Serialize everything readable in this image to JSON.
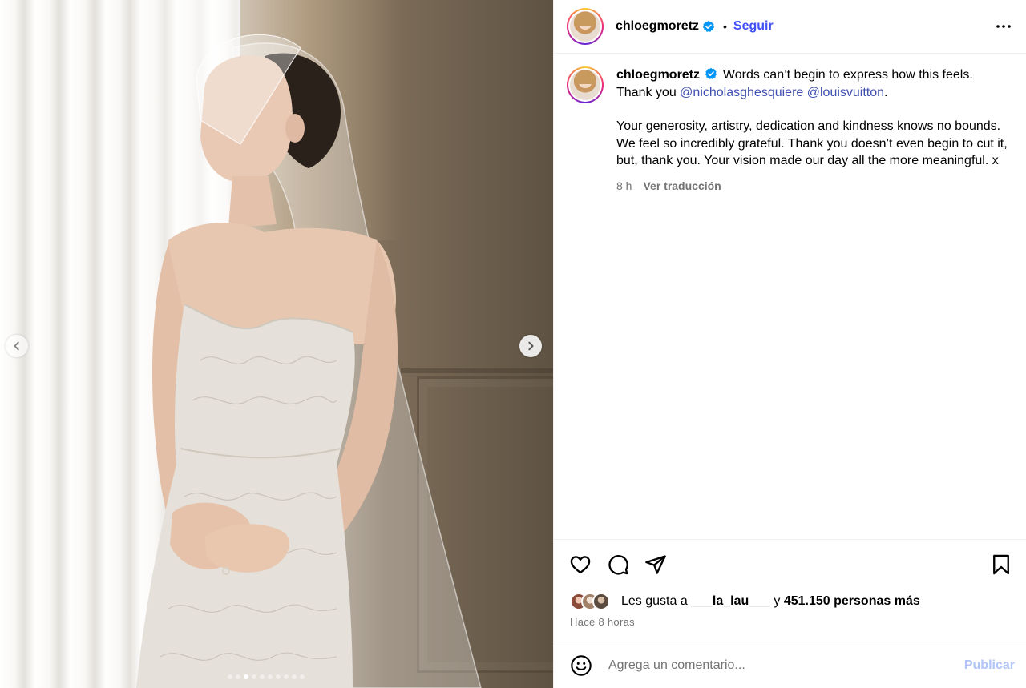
{
  "post": {
    "username": "chloegmoretz",
    "separator": "•",
    "follow_label": "Seguir",
    "more_icon": "more-horizontal-icon",
    "verified_icon": "verified-badge-icon"
  },
  "caption": {
    "username": "chloegmoretz",
    "line1": "Words can’t begin to express how this feels.",
    "thank_you": "Thank you",
    "mention1": "@nicholasghesquiere",
    "mention2": "@louisvuitton",
    "period": ".",
    "paragraph2": "Your generosity, artistry, dedication and kindness knows no bounds. We feel so incredibly grateful. Thank you doesn’t even begin to cut it, but, thank you. Your vision made our day all the more meaningful. x",
    "time_ago": "8 h",
    "translate_label": "Ver traducción"
  },
  "carousel": {
    "total_slides": 10,
    "active_index": 2
  },
  "actions": {
    "like_icon": "heart-icon",
    "comment_icon": "comment-bubble-icon",
    "share_icon": "paper-plane-icon",
    "save_icon": "bookmark-icon"
  },
  "likes": {
    "prefix": "Les gusta a",
    "user": "___la_lau___",
    "connector": "y",
    "count_text": "451.150 personas más"
  },
  "timestamp": "Hace 8 horas",
  "comment_box": {
    "placeholder": "Agrega un comentario...",
    "publish_label": "Publicar",
    "emoji_icon": "emoji-smile-icon"
  },
  "colors": {
    "link_blue": "#4150f7",
    "mention_blue": "#4150b0",
    "verified_blue": "#0095f6",
    "muted_gray": "#737373",
    "publish_disabled": "#b2c5f8"
  }
}
